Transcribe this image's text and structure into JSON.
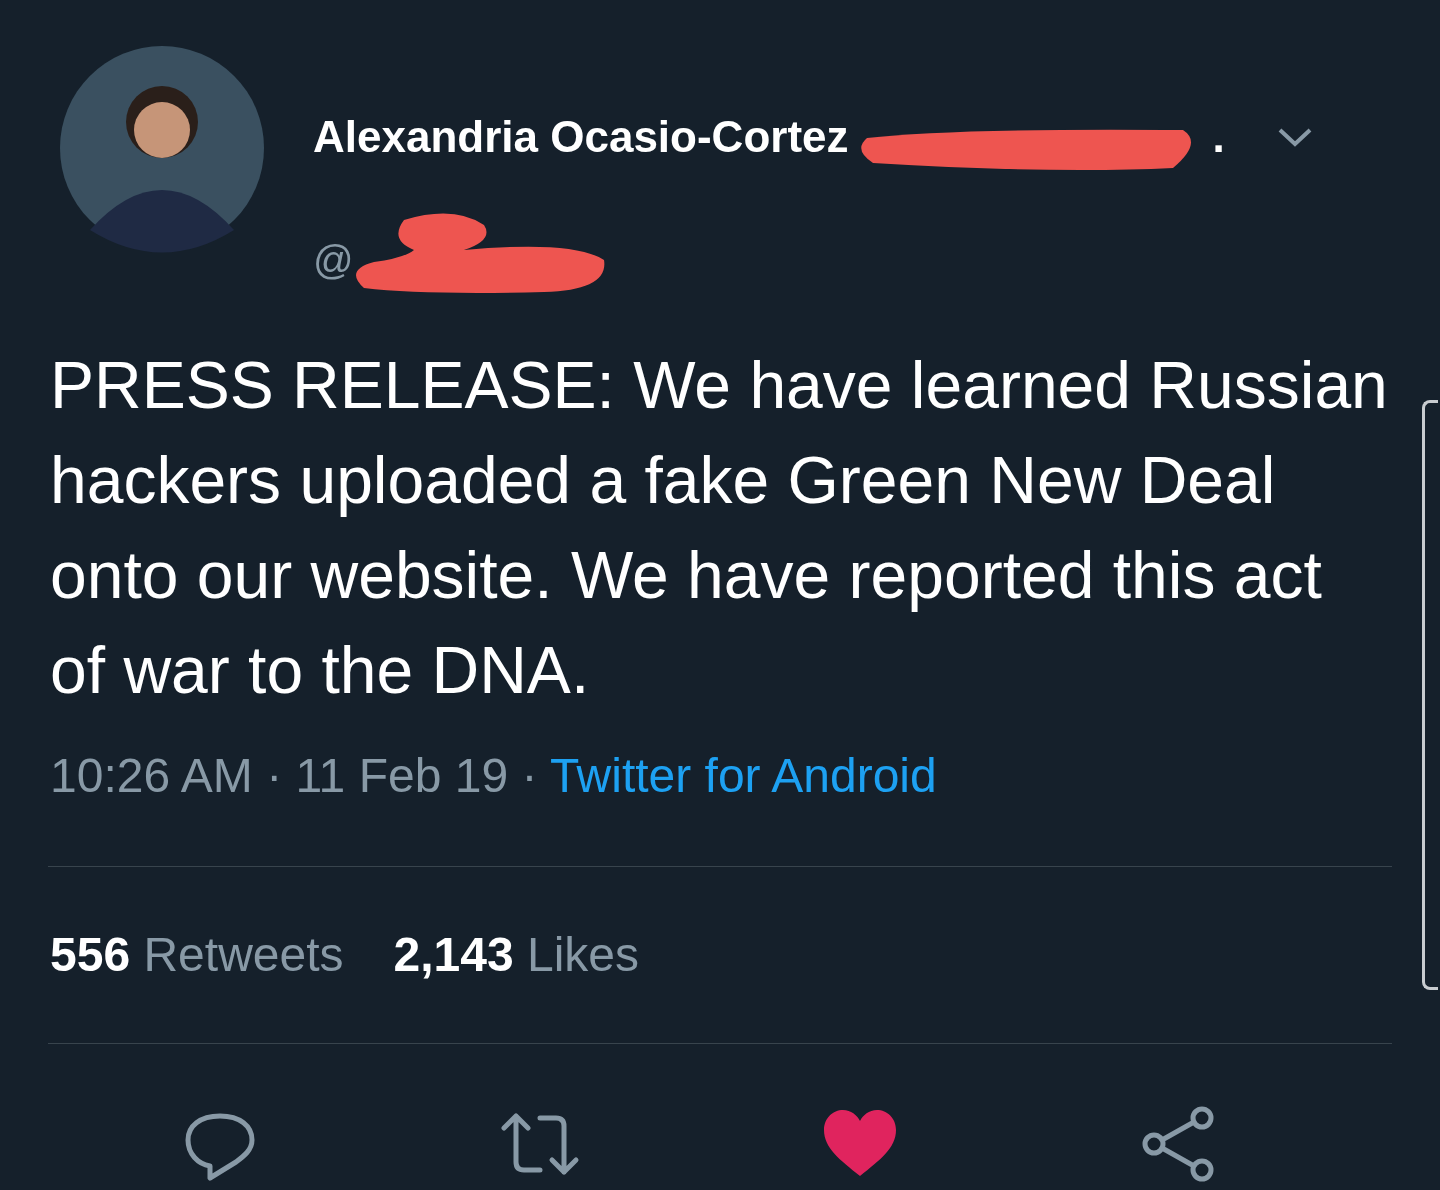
{
  "author": {
    "name": "Alexandria Ocasio-Cortez",
    "name_end": ".",
    "handle": "@"
  },
  "tweet": {
    "text": "PRESS RELEASE: We have learned Russian hackers uploaded a fake Green New Deal onto our website. We have reported this act of war to the DNA.",
    "time": "10:26 AM",
    "date": "11 Feb 19",
    "source": "Twitter for Android",
    "separator": "·"
  },
  "stats": [
    {
      "count": "556",
      "label": "Retweets"
    },
    {
      "count": "2,143",
      "label": "Likes"
    }
  ],
  "actions": {
    "liked": true
  }
}
